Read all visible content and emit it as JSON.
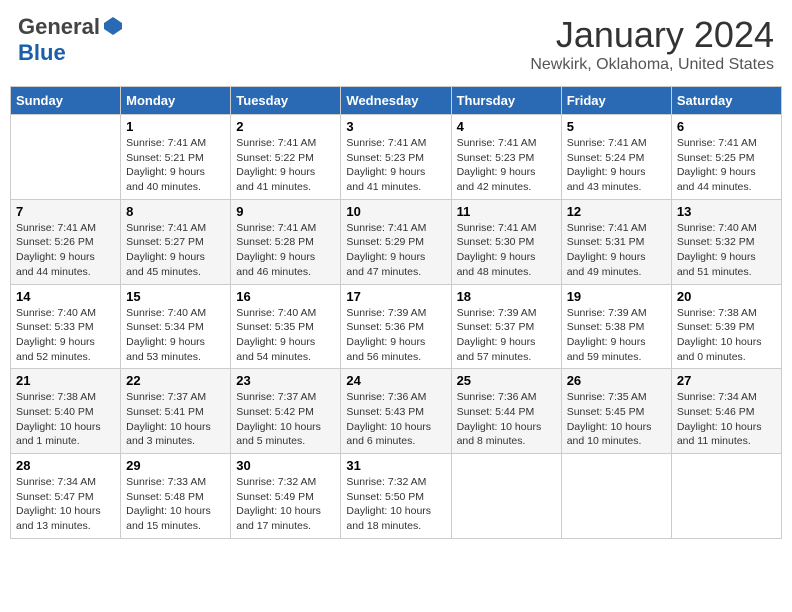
{
  "header": {
    "logo_general": "General",
    "logo_blue": "Blue",
    "month": "January 2024",
    "location": "Newkirk, Oklahoma, United States"
  },
  "weekdays": [
    "Sunday",
    "Monday",
    "Tuesday",
    "Wednesday",
    "Thursday",
    "Friday",
    "Saturday"
  ],
  "weeks": [
    [
      {
        "day": "",
        "info": ""
      },
      {
        "day": "1",
        "info": "Sunrise: 7:41 AM\nSunset: 5:21 PM\nDaylight: 9 hours\nand 40 minutes."
      },
      {
        "day": "2",
        "info": "Sunrise: 7:41 AM\nSunset: 5:22 PM\nDaylight: 9 hours\nand 41 minutes."
      },
      {
        "day": "3",
        "info": "Sunrise: 7:41 AM\nSunset: 5:23 PM\nDaylight: 9 hours\nand 41 minutes."
      },
      {
        "day": "4",
        "info": "Sunrise: 7:41 AM\nSunset: 5:23 PM\nDaylight: 9 hours\nand 42 minutes."
      },
      {
        "day": "5",
        "info": "Sunrise: 7:41 AM\nSunset: 5:24 PM\nDaylight: 9 hours\nand 43 minutes."
      },
      {
        "day": "6",
        "info": "Sunrise: 7:41 AM\nSunset: 5:25 PM\nDaylight: 9 hours\nand 44 minutes."
      }
    ],
    [
      {
        "day": "7",
        "info": "Sunrise: 7:41 AM\nSunset: 5:26 PM\nDaylight: 9 hours\nand 44 minutes."
      },
      {
        "day": "8",
        "info": "Sunrise: 7:41 AM\nSunset: 5:27 PM\nDaylight: 9 hours\nand 45 minutes."
      },
      {
        "day": "9",
        "info": "Sunrise: 7:41 AM\nSunset: 5:28 PM\nDaylight: 9 hours\nand 46 minutes."
      },
      {
        "day": "10",
        "info": "Sunrise: 7:41 AM\nSunset: 5:29 PM\nDaylight: 9 hours\nand 47 minutes."
      },
      {
        "day": "11",
        "info": "Sunrise: 7:41 AM\nSunset: 5:30 PM\nDaylight: 9 hours\nand 48 minutes."
      },
      {
        "day": "12",
        "info": "Sunrise: 7:41 AM\nSunset: 5:31 PM\nDaylight: 9 hours\nand 49 minutes."
      },
      {
        "day": "13",
        "info": "Sunrise: 7:40 AM\nSunset: 5:32 PM\nDaylight: 9 hours\nand 51 minutes."
      }
    ],
    [
      {
        "day": "14",
        "info": "Sunrise: 7:40 AM\nSunset: 5:33 PM\nDaylight: 9 hours\nand 52 minutes."
      },
      {
        "day": "15",
        "info": "Sunrise: 7:40 AM\nSunset: 5:34 PM\nDaylight: 9 hours\nand 53 minutes."
      },
      {
        "day": "16",
        "info": "Sunrise: 7:40 AM\nSunset: 5:35 PM\nDaylight: 9 hours\nand 54 minutes."
      },
      {
        "day": "17",
        "info": "Sunrise: 7:39 AM\nSunset: 5:36 PM\nDaylight: 9 hours\nand 56 minutes."
      },
      {
        "day": "18",
        "info": "Sunrise: 7:39 AM\nSunset: 5:37 PM\nDaylight: 9 hours\nand 57 minutes."
      },
      {
        "day": "19",
        "info": "Sunrise: 7:39 AM\nSunset: 5:38 PM\nDaylight: 9 hours\nand 59 minutes."
      },
      {
        "day": "20",
        "info": "Sunrise: 7:38 AM\nSunset: 5:39 PM\nDaylight: 10 hours\nand 0 minutes."
      }
    ],
    [
      {
        "day": "21",
        "info": "Sunrise: 7:38 AM\nSunset: 5:40 PM\nDaylight: 10 hours\nand 1 minute."
      },
      {
        "day": "22",
        "info": "Sunrise: 7:37 AM\nSunset: 5:41 PM\nDaylight: 10 hours\nand 3 minutes."
      },
      {
        "day": "23",
        "info": "Sunrise: 7:37 AM\nSunset: 5:42 PM\nDaylight: 10 hours\nand 5 minutes."
      },
      {
        "day": "24",
        "info": "Sunrise: 7:36 AM\nSunset: 5:43 PM\nDaylight: 10 hours\nand 6 minutes."
      },
      {
        "day": "25",
        "info": "Sunrise: 7:36 AM\nSunset: 5:44 PM\nDaylight: 10 hours\nand 8 minutes."
      },
      {
        "day": "26",
        "info": "Sunrise: 7:35 AM\nSunset: 5:45 PM\nDaylight: 10 hours\nand 10 minutes."
      },
      {
        "day": "27",
        "info": "Sunrise: 7:34 AM\nSunset: 5:46 PM\nDaylight: 10 hours\nand 11 minutes."
      }
    ],
    [
      {
        "day": "28",
        "info": "Sunrise: 7:34 AM\nSunset: 5:47 PM\nDaylight: 10 hours\nand 13 minutes."
      },
      {
        "day": "29",
        "info": "Sunrise: 7:33 AM\nSunset: 5:48 PM\nDaylight: 10 hours\nand 15 minutes."
      },
      {
        "day": "30",
        "info": "Sunrise: 7:32 AM\nSunset: 5:49 PM\nDaylight: 10 hours\nand 17 minutes."
      },
      {
        "day": "31",
        "info": "Sunrise: 7:32 AM\nSunset: 5:50 PM\nDaylight: 10 hours\nand 18 minutes."
      },
      {
        "day": "",
        "info": ""
      },
      {
        "day": "",
        "info": ""
      },
      {
        "day": "",
        "info": ""
      }
    ]
  ]
}
